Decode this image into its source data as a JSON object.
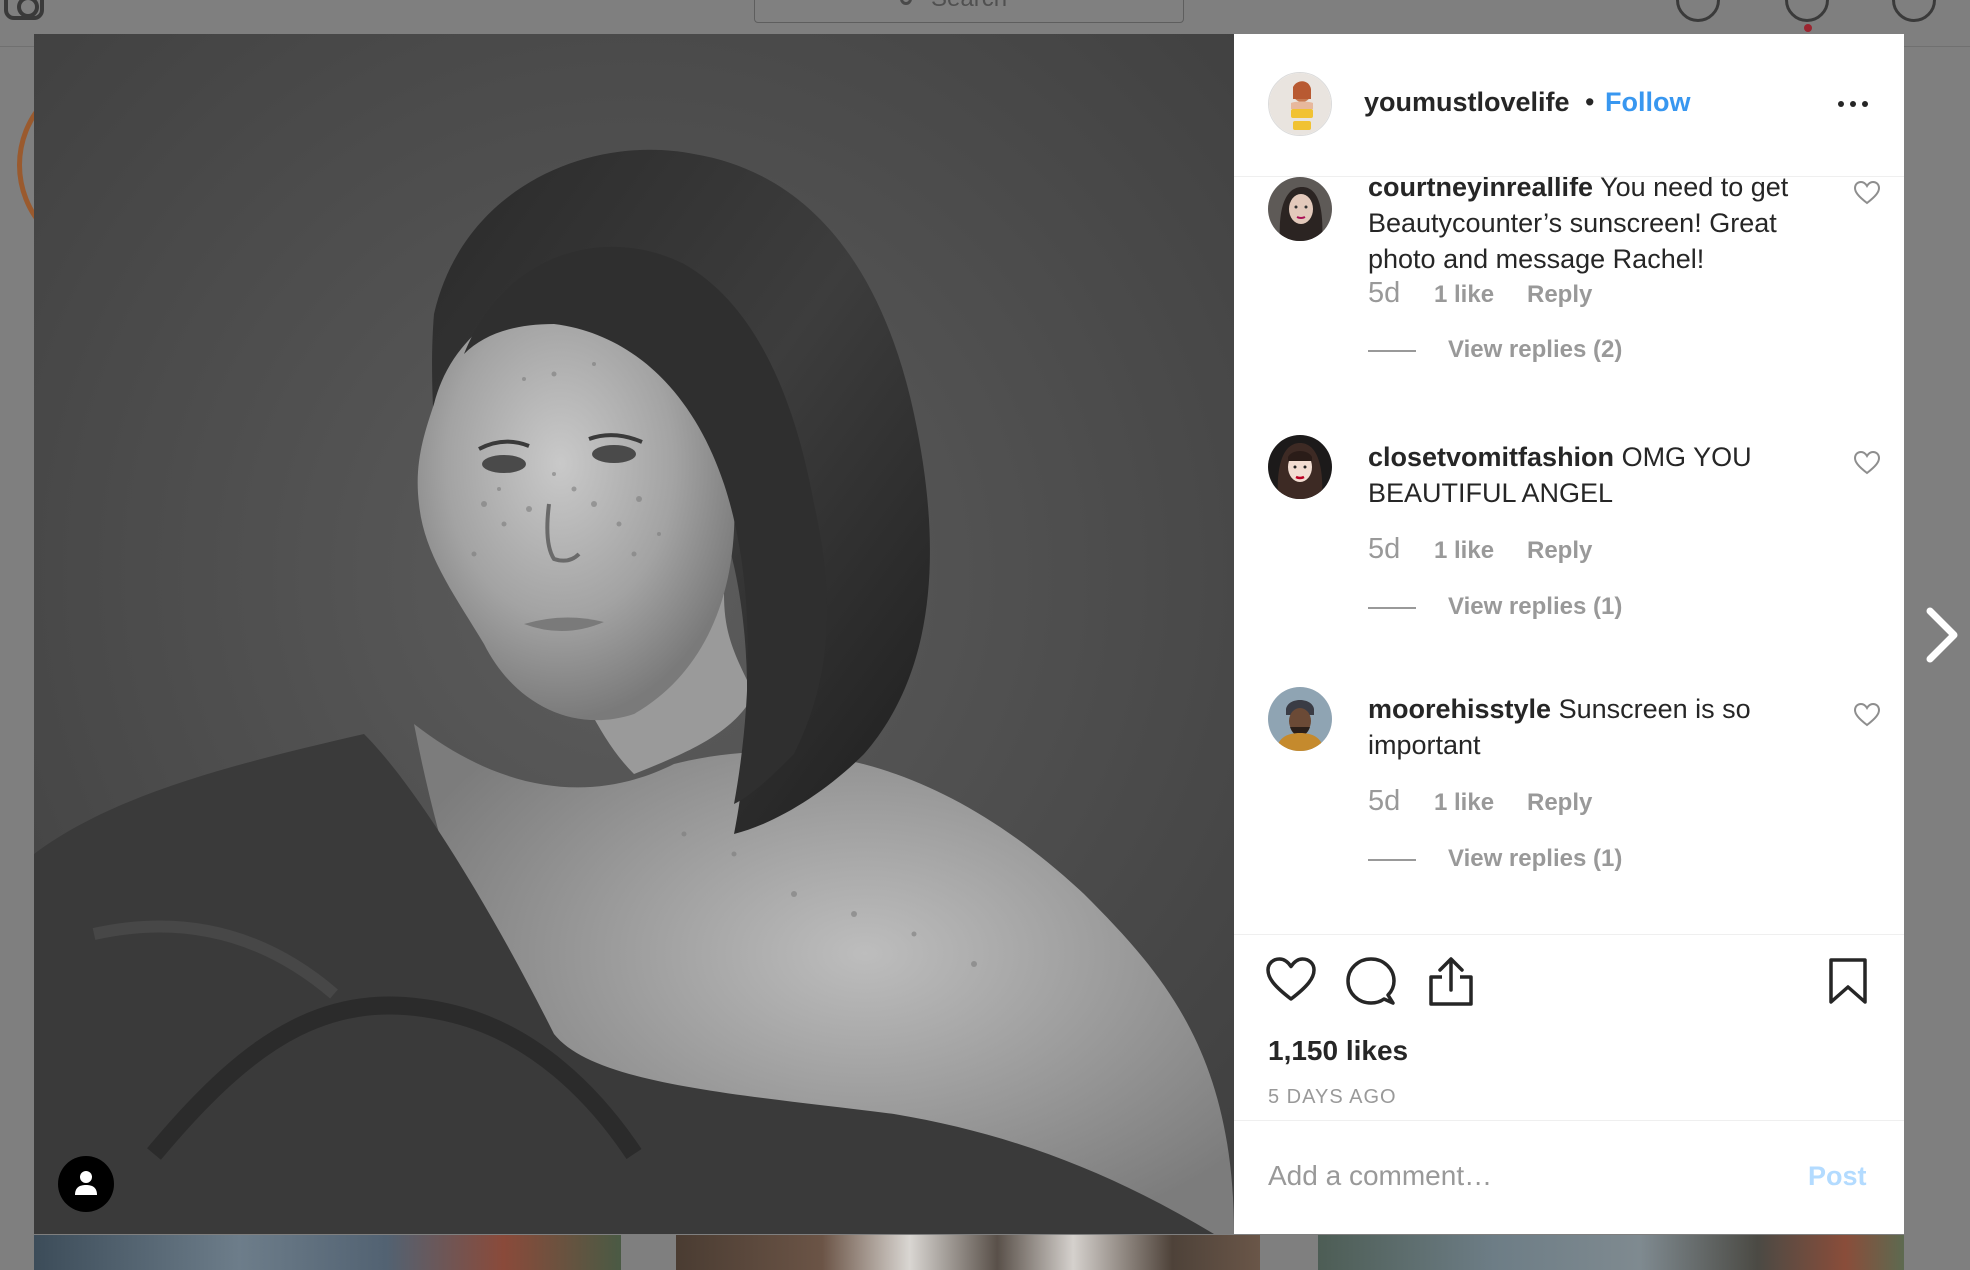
{
  "topbar": {
    "search_placeholder": "Search",
    "icons": [
      "instagram-logo-icon",
      "search-icon",
      "compass-icon",
      "heart-icon",
      "profile-icon"
    ]
  },
  "post": {
    "author": "youmustlovelife",
    "separator": "•",
    "follow_label": "Follow",
    "likes": "1,150 likes",
    "time_ago": "5 DAYS AGO",
    "photo_description_icon": "user-tag-icon"
  },
  "comments": [
    {
      "username": "courtneyinreallife",
      "text": "You need to get Beautycounter’s sunscreen! Great photo and message Rachel!",
      "time": "5d",
      "likes": "1 like",
      "reply_label": "Reply",
      "view_replies": "View replies (2)"
    },
    {
      "username": "closetvomitfashion",
      "text": "OMG YOU BEAUTIFUL ANGEL",
      "time": "5d",
      "likes": "1 like",
      "reply_label": "Reply",
      "view_replies": "View replies (1)"
    },
    {
      "username": "moorehisstyle",
      "text": "Sunscreen is so important",
      "time": "5d",
      "likes": "1 like",
      "reply_label": "Reply",
      "view_replies": "View replies (1)"
    }
  ],
  "comment_box": {
    "placeholder": "Add a comment…",
    "post_label": "Post"
  },
  "colors": {
    "link_blue": "#3897f0",
    "post_disabled": "#b3dbff",
    "muted_text": "#999999",
    "notification_dot": "#ed4956"
  }
}
